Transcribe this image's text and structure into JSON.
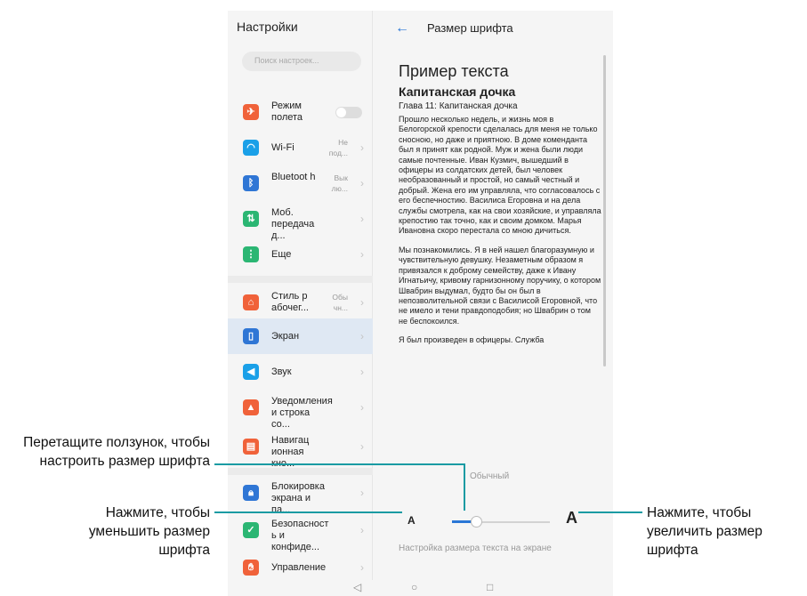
{
  "settings": {
    "title": "Настройки",
    "search_placeholder": "Поиск настроек...",
    "items": [
      {
        "label": "Режим полета",
        "value": "",
        "icon": "airplane-icon",
        "color": "#f0623a"
      },
      {
        "label": "Wi-Fi",
        "value": "Не под...",
        "icon": "wifi-icon",
        "color": "#1aa0e8"
      },
      {
        "label": "Bluetoot h",
        "value": "Вык лю...",
        "icon": "bluetooth-icon",
        "color": "#2f76d5"
      },
      {
        "label": "Моб. передача д...",
        "value": "",
        "icon": "mobile-data-icon",
        "color": "#2bb673"
      },
      {
        "label": "Еще",
        "value": "",
        "icon": "more-icon",
        "color": "#2bb673"
      },
      {
        "label": "Стиль р абочег...",
        "value": "Обы чн...",
        "icon": "home-style-icon",
        "color": "#f0623a"
      },
      {
        "label": "Экран",
        "value": "",
        "icon": "display-icon",
        "color": "#2f76d5"
      },
      {
        "label": "Звук",
        "value": "",
        "icon": "sound-icon",
        "color": "#1aa0e8"
      },
      {
        "label": "Уведомления и строка со...",
        "value": "",
        "icon": "notification-icon",
        "color": "#f0623a"
      },
      {
        "label": "Навигац ионная кно...",
        "value": "",
        "icon": "navigation-icon",
        "color": "#f0623a"
      },
      {
        "label": "Блокировка экрана и па...",
        "value": "",
        "icon": "lock-icon",
        "color": "#2f76d5"
      },
      {
        "label": "Безопасност ь и конфиде...",
        "value": "",
        "icon": "security-icon",
        "color": "#2bb673"
      },
      {
        "label": "Управление",
        "value": "",
        "icon": "gesture-icon",
        "color": "#f0623a"
      }
    ]
  },
  "font_size": {
    "back_icon": "←",
    "title": "Размер шрифта",
    "sample_heading": "Пример текста",
    "sample_title": "Капитанская дочка",
    "sample_chapter": "Глава 11: Капитанская дочка",
    "paragraph1": "Прошло несколько недель, и жизнь моя в Белогорской крепости сделалась для меня не только сносною, но даже и приятною. В доме коменданта был я принят как родной. Муж и жена были люди самые почтенные. Иван Кузмич, вышедший в офицеры из солдатских детей, был человек необразованный и простой, но самый честный и добрый. Жена его им управляла, что согласовалось с его беспечностию. Василиса Егоровна и на дела службы смотрела, как на свои хозяйские, и управляла крепостию так точно, как и своим домком. Марья Ивановна скоро перестала со мною дичиться.",
    "paragraph2": "Мы познакомились. Я в ней нашел благоразумную и чувствительную девушку. Незаметным образом я привязался к доброму семейству, даже к Ивану Игнатьичу, кривому гарнизонному поручику, о котором Швабрин выдумал, будто бы он был в непозволительной связи с Василисой Егоровной, что не имело и тени правдоподобия; но Швабрин о том не беспокоился.",
    "paragraph3": "Я был произведен в офицеры. Служба",
    "size_label": "Обычный",
    "a_small": "A",
    "a_large": "A",
    "slider_level": 0.25,
    "description": "Настройка размера текста на экране",
    "accent": "#2a77d6"
  },
  "navbar": {
    "back": "◁",
    "home": "○",
    "recent": "□"
  },
  "callouts": {
    "drag": "Перетащите ползунок, чтобы настроить размер шрифта",
    "decrease": "Нажмите, чтобы уменьшить размер шрифта",
    "increase": "Нажмите, чтобы увеличить размер шрифта"
  }
}
